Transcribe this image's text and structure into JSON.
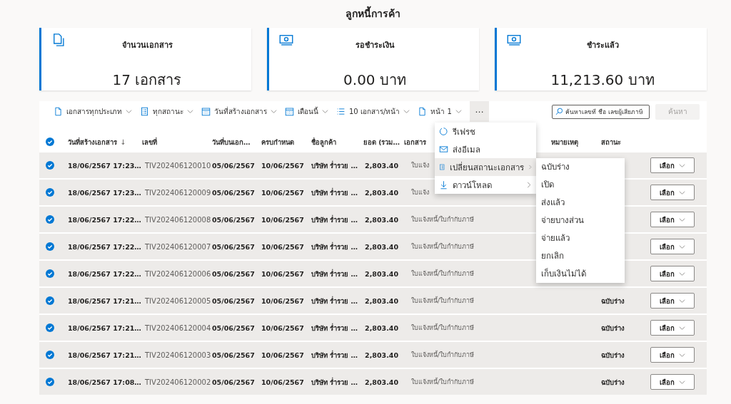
{
  "title": "ลูกหนี้การค้า",
  "summary_cards": [
    {
      "kind": "count",
      "label": "จำนวนเอกสาร",
      "value": "17 เอกสาร"
    },
    {
      "kind": "amount",
      "label": "รอชำระเงิน",
      "value": "0.00 บาท"
    },
    {
      "kind": "amount",
      "label": "ชำระแล้ว",
      "value": "11,213.60 บาท"
    }
  ],
  "toolbar": {
    "filters": [
      {
        "kind": "type",
        "label": "เอกสารทุกประเภท"
      },
      {
        "kind": "status",
        "label": "ทุกสถานะ"
      },
      {
        "kind": "date",
        "label": "วันที่สร้างเอกสาร"
      },
      {
        "kind": "date",
        "label": "เดือนนี้"
      },
      {
        "kind": "pagesize",
        "label": "10 เอกสาร/หน้า"
      },
      {
        "kind": "page",
        "label": "หน้า 1"
      }
    ],
    "more": {
      "label": "⋯",
      "expanded": true,
      "menu": [
        {
          "kind": "refresh",
          "label": "รีเฟรช",
          "has_submenu": false,
          "selected": false
        },
        {
          "kind": "email",
          "label": "ส่งอีเมล",
          "has_submenu": false,
          "selected": false
        },
        {
          "kind": "status",
          "label": "เปลี่ยนสถานะเอกสาร",
          "has_submenu": true,
          "selected": true,
          "submenu": [
            "ฉบับร่าง",
            "เปิด",
            "ส่งแล้ว",
            "จ่ายบางส่วน",
            "จ่ายแล้ว",
            "ยกเลิก",
            "เก็บเงินไม่ได้"
          ]
        },
        {
          "kind": "download",
          "label": "ดาวน์โหลด",
          "has_submenu": true,
          "selected": false
        }
      ]
    },
    "search": {
      "placeholder": "ค้นหาเลขที่ ชื่อ เลขผู้เสียภาษี"
    },
    "search_button": {
      "label": "ค้นหา",
      "disabled": true
    }
  },
  "table": {
    "select_all": {
      "checked": true
    },
    "columns": [
      {
        "label": "วันที่สร้างเอกสาร",
        "sort_icon": "↓"
      },
      {
        "label": "เลขที่"
      },
      {
        "label": "วันที่บนเอก…"
      },
      {
        "label": "ครบกำหนด"
      },
      {
        "label": "ชื่อลูกค้า"
      },
      {
        "label": "ยอด (รวม…"
      },
      {
        "label": "เอกสาร"
      },
      {
        "label": "หมายเหตุ"
      },
      {
        "label": "สถานะ"
      }
    ],
    "rows": [
      {
        "selected": true,
        "created": "18/06/2567 17:23…",
        "number": "TIV202406120010",
        "doc_date": "05/06/2567",
        "due": "10/06/2567",
        "customer": "บริษัท ร่ำรวย …",
        "amount": "2,803.40",
        "doc_type": "ใบแจ้ง",
        "action": "เลือก"
      },
      {
        "selected": true,
        "created": "18/06/2567 17:23…",
        "number": "TIV202406120009",
        "doc_date": "05/06/2567",
        "due": "10/06/2567",
        "customer": "บริษัท ร่ำรวย …",
        "amount": "2,803.40",
        "doc_type": "ใบแจ้ง",
        "action": "เลือก"
      },
      {
        "selected": true,
        "created": "18/06/2567 17:22…",
        "number": "TIV202406120008",
        "doc_date": "05/06/2567",
        "due": "10/06/2567",
        "customer": "บริษัท ร่ำรวย …",
        "amount": "2,803.40",
        "doc_type": "ใบแจ้งหนี้/ใบกำกับภาษี",
        "action": "เลือก"
      },
      {
        "selected": true,
        "created": "18/06/2567 17:22…",
        "number": "TIV202406120007",
        "doc_date": "05/06/2567",
        "due": "10/06/2567",
        "customer": "บริษัท ร่ำรวย …",
        "amount": "2,803.40",
        "doc_type": "ใบแจ้งหนี้/ใบกำกับภาษี",
        "action": "เลือก"
      },
      {
        "selected": true,
        "created": "18/06/2567 17:22…",
        "number": "TIV202406120006",
        "doc_date": "05/06/2567",
        "due": "10/06/2567",
        "customer": "บริษัท ร่ำรวย …",
        "amount": "2,803.40",
        "doc_type": "ใบแจ้งหนี้/ใบกำกับภาษี",
        "action": "เลือก"
      },
      {
        "selected": true,
        "created": "18/06/2567 17:21…",
        "number": "TIV202406120005",
        "doc_date": "05/06/2567",
        "due": "10/06/2567",
        "customer": "บริษัท ร่ำรวย …",
        "amount": "2,803.40",
        "doc_type": "ใบแจ้งหนี้/ใบกำกับภาษี",
        "status": "ฉบับร่าง",
        "action": "เลือก"
      },
      {
        "selected": true,
        "created": "18/06/2567 17:21…",
        "number": "TIV202406120004",
        "doc_date": "05/06/2567",
        "due": "10/06/2567",
        "customer": "บริษัท ร่ำรวย …",
        "amount": "2,803.40",
        "doc_type": "ใบแจ้งหนี้/ใบกำกับภาษี",
        "status": "ฉบับร่าง",
        "action": "เลือก"
      },
      {
        "selected": true,
        "created": "18/06/2567 17:21…",
        "number": "TIV202406120003",
        "doc_date": "05/06/2567",
        "due": "10/06/2567",
        "customer": "บริษัท ร่ำรวย …",
        "amount": "2,803.40",
        "doc_type": "ใบแจ้งหนี้/ใบกำกับภาษี",
        "status": "ฉบับร่าง",
        "action": "เลือก"
      },
      {
        "selected": true,
        "created": "18/06/2567 17:08…",
        "number": "TIV202406120002",
        "doc_date": "05/06/2567",
        "due": "10/06/2567",
        "customer": "บริษัท ร่ำรวย …",
        "amount": "2,803.40",
        "doc_type": "ใบแจ้งหนี้/ใบกำกับภาษี",
        "status": "ฉบับร่าง",
        "action": "เลือก"
      }
    ]
  }
}
